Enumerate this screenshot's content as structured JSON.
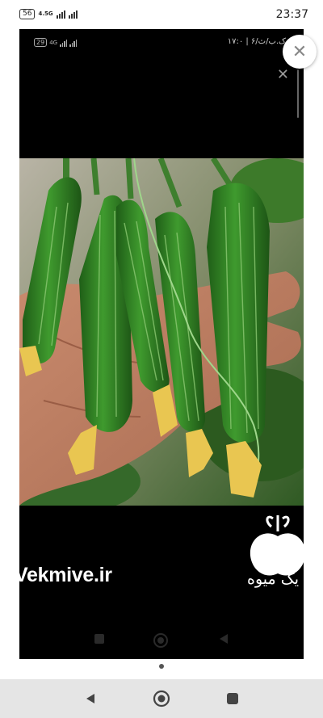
{
  "status_bar": {
    "battery_level": "56",
    "network_type": "4.5G",
    "network_sub": "4.5G",
    "time": "23:37"
  },
  "inner_status": {
    "battery_level": "29",
    "network_type": "4G",
    "right_text": "۱۷:۰ | ۶/ک.ب/ث"
  },
  "watermark": {
    "site": "Vekmive.ir",
    "brand": "یک میوه"
  },
  "colors": {
    "cucumber": "#2f7d22",
    "navbar": "#e5e5e5"
  },
  "icons": [
    "close-icon",
    "back-icon",
    "home-icon",
    "recents-icon"
  ]
}
